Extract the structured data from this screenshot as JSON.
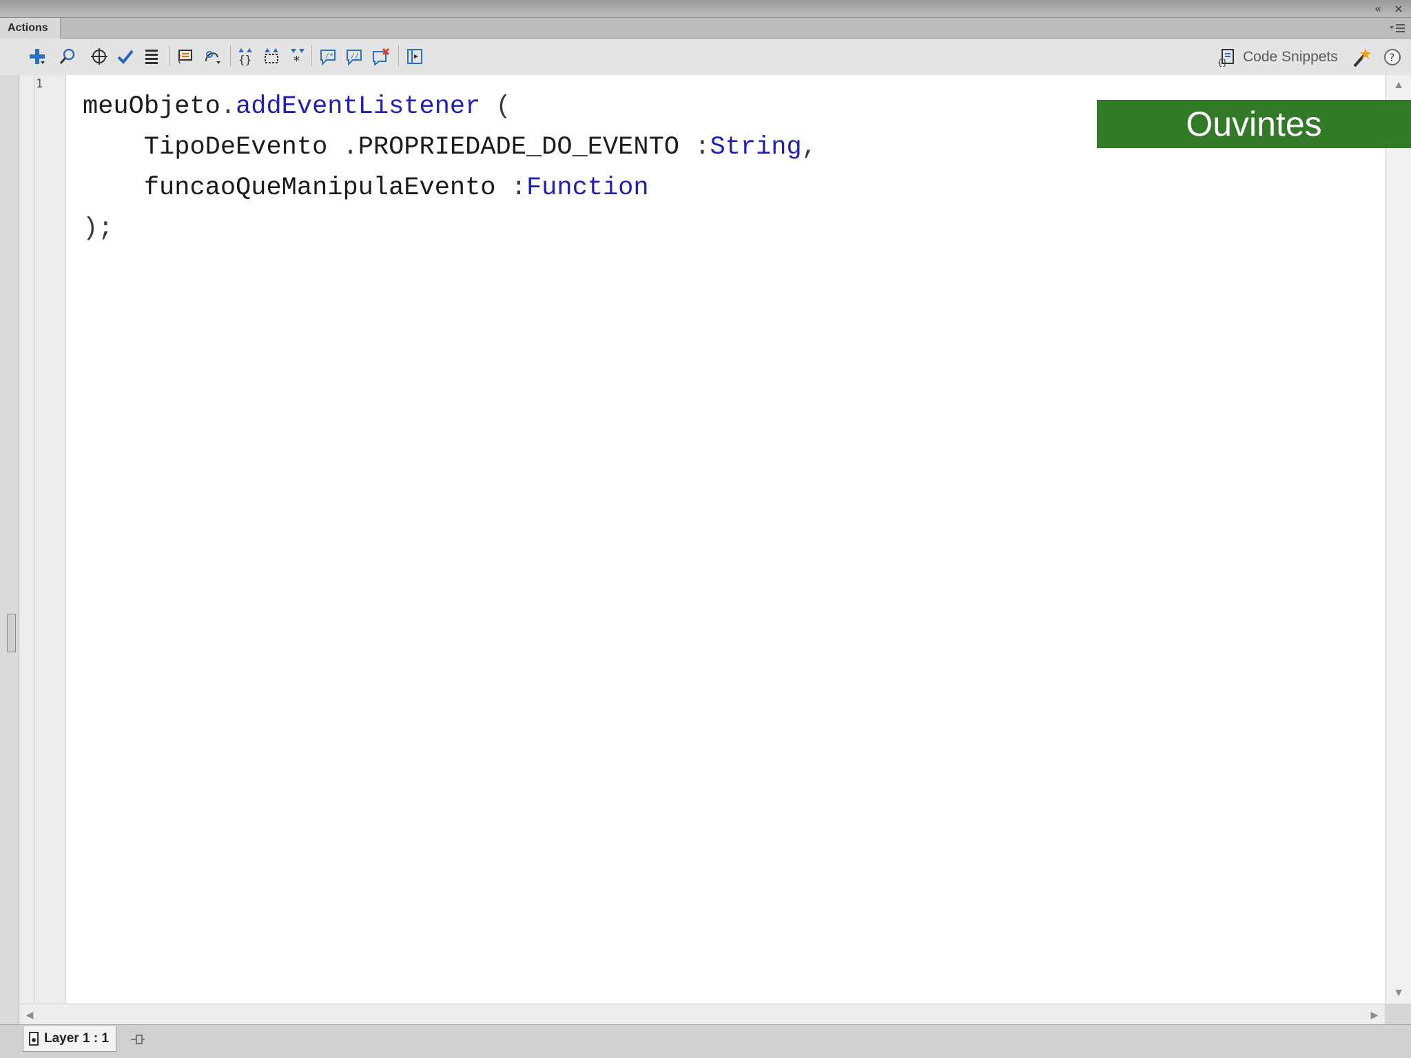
{
  "window": {
    "panel_tab": "Actions"
  },
  "toolbar": {
    "tools": [
      "add-script-item-icon",
      "find-icon",
      "insert-target-path-icon",
      "check-syntax-icon",
      "auto-format-icon",
      "show-code-hint-icon",
      "debug-options-icon",
      "collapse-between-braces-icon",
      "collapse-selection-icon",
      "expand-all-icon",
      "apply-block-comment-icon",
      "apply-line-comment-icon",
      "remove-comment-icon",
      "show-hide-toolbox-icon"
    ],
    "code_snippets_label": "Code Snippets"
  },
  "editor": {
    "line_numbers": [
      "1"
    ],
    "code": {
      "line1_object": "meuObjeto",
      "line1_dot": ".",
      "line1_method": "addEventListener",
      "line1_paren": "(",
      "line2_class": "TipoDeEvento",
      "line2_dot": ".",
      "line2_prop": "PROPRIEDADE_DO_EVENTO",
      "line2_colon": ":",
      "line2_type": "String",
      "line2_comma": ",",
      "line3_param": "funcaoQueManipulaEvento",
      "line3_colon": ":",
      "line3_type": "Function",
      "line4_close": ");"
    }
  },
  "status": {
    "layer_label": "Layer 1 : 1"
  },
  "overlay": {
    "title": "Ouvintes",
    "color": "#337a28"
  }
}
